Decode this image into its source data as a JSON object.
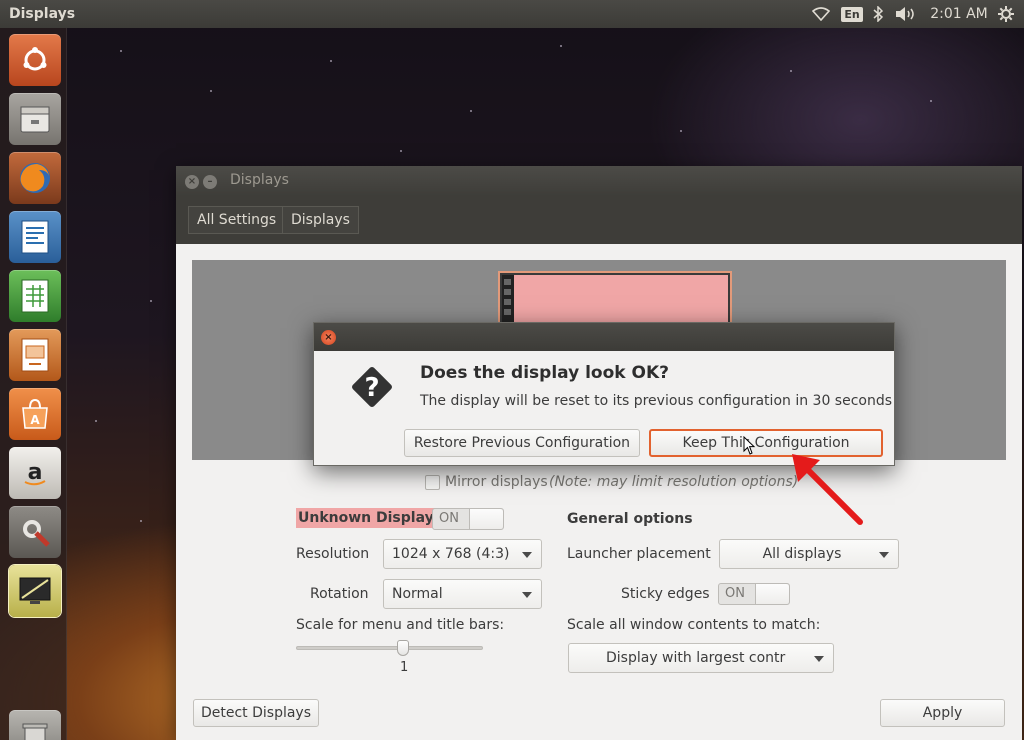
{
  "panel": {
    "title": "Displays",
    "keyboard_layout": "En",
    "clock": "2:01 AM",
    "icons": [
      "wifi-icon",
      "bluetooth-icon",
      "volume-icon",
      "power-gear-icon"
    ]
  },
  "launcher": {
    "items": [
      {
        "name": "ubuntu-dash",
        "color": "#d05a2a"
      },
      {
        "name": "files",
        "color": "#8a8680"
      },
      {
        "name": "firefox",
        "color": "#2f6ab3"
      },
      {
        "name": "libreoffice-writer",
        "color": "#2a6fb0"
      },
      {
        "name": "libreoffice-calc",
        "color": "#3e9a3a"
      },
      {
        "name": "libreoffice-impress",
        "color": "#c8661e"
      },
      {
        "name": "ubuntu-software",
        "color": "#e3762a"
      },
      {
        "name": "amazon",
        "color": "#d9d6d1"
      },
      {
        "name": "system-settings",
        "color": "#b23b2a"
      },
      {
        "name": "displays",
        "color": "#d9d35a"
      },
      {
        "name": "trash",
        "color": "#9a9894"
      }
    ]
  },
  "window": {
    "title": "Displays",
    "breadcrumbs": [
      "All Settings",
      "Displays"
    ]
  },
  "preview": {
    "monitor_color": "#f0a6a6"
  },
  "dialog": {
    "title": "Does the display look OK?",
    "message": "The display will be reset to its previous configuration in 30 seconds",
    "restore_label": "Restore Previous Configuration",
    "keep_label": "Keep This Configuration"
  },
  "mirror": {
    "label": "Mirror displays",
    "note": "(Note: may limit resolution options)",
    "checked": false
  },
  "display_settings": {
    "display_name": "Unknown Display",
    "power_state": "ON",
    "resolution_label": "Resolution",
    "resolution_value": "1024 x 768 (4:3)",
    "rotation_label": "Rotation",
    "rotation_value": "Normal",
    "scale_label": "Scale for menu and title bars:",
    "scale_value": "1"
  },
  "general_options": {
    "heading": "General options",
    "launcher_placement_label": "Launcher placement",
    "launcher_placement_value": "All displays",
    "sticky_edges_label": "Sticky edges",
    "sticky_edges_state": "ON",
    "scale_all_label": "Scale all window contents to match:",
    "scale_all_value": "Display with largest contr"
  },
  "footer": {
    "detect_label": "Detect Displays",
    "apply_label": "Apply"
  },
  "colors": {
    "display_highlight": "#f0a6a6",
    "keep_button_border": "#e2622f",
    "annotation_arrow": "#e41b1b"
  }
}
